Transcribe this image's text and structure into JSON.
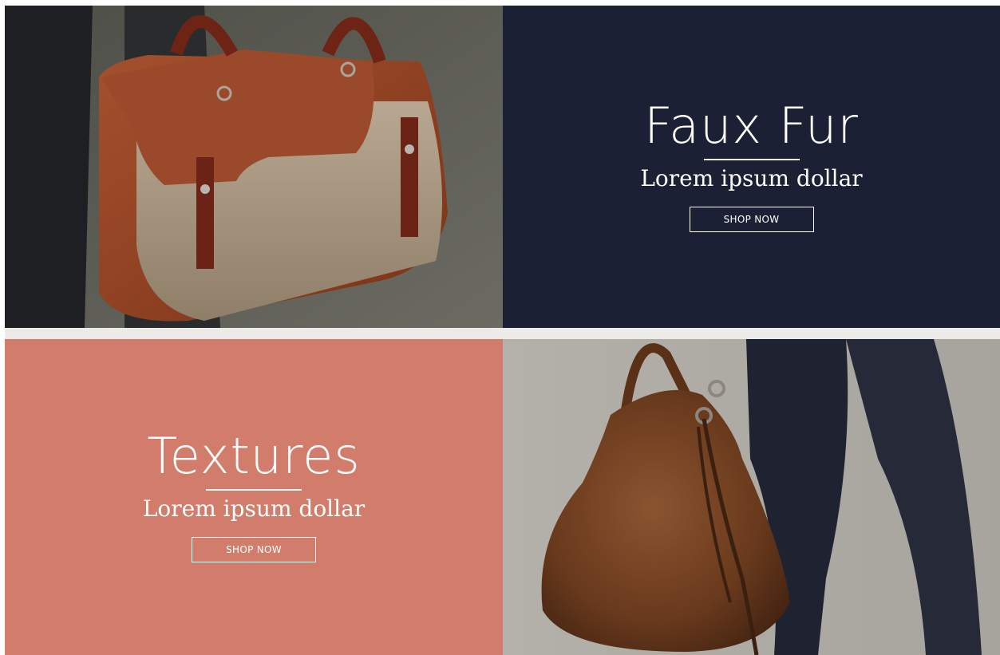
{
  "colors": {
    "navy_panel": "#1c2034",
    "coral_panel": "#d27d6b",
    "text": "#ffffff",
    "divider_band": "#ecebe8"
  },
  "promos": [
    {
      "title": "Faux Fur",
      "subtitle": "Lorem ipsum dollar",
      "button_label": "SHOP NOW"
    },
    {
      "title": "Textures",
      "subtitle": "Lorem ipsum dollar",
      "button_label": "SHOP NOW"
    }
  ]
}
